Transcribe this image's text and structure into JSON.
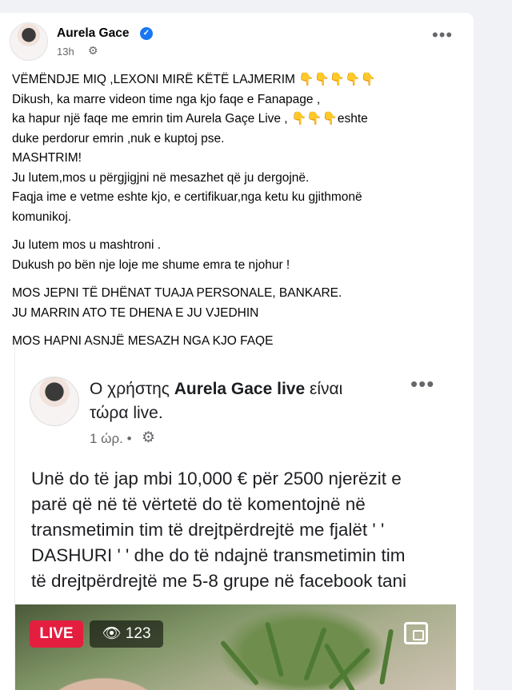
{
  "post": {
    "author": "Aurela Gace",
    "time": "13h",
    "more": "•••",
    "lines": [
      "VËMËNDJE MIQ ,LEXONI MIRË KËTË LAJMERIM",
      "Dikush, ka marre videon time nga kjo faqe e Fanapage ,",
      "  ka hapur një  faqe me emrin tim Aurela Gaçe Live ,",
      "duke perdorur emrin ,nuk e kuptoj pse.",
      "MASHTRIM!",
      "Ju lutem,mos u përgjigjni në mesazhet që ju dergojnë.",
      "Faqja ime e vetme eshte  kjo, e certifikuar,nga ketu ku gjithmonë",
      "komunikoj.",
      "Ju lutem mos u mashtroni .",
      "Dukush po bën nje loje me shume emra te njohur !",
      "MOS JEPNI TË DHËNAT TUAJA PERSONALE, BANKARE.",
      "JU MARRIN ATO TE DHENA E JU VJEDHIN",
      "MOS HAPNI ASNJË MESAZH NGA KJO FAQE"
    ],
    "emoji_line1": "👇👇👇👇👇",
    "emoji_line3": "👇👇👇",
    "line3_suffix": "eshte"
  },
  "screenshot": {
    "prefix": "Ο χρήστης ",
    "name": "Aurela Gace live",
    "suffix": " είναι",
    "line2": "τώρα live.",
    "time": "1 ώρ. •",
    "more": "•••",
    "body": [
      "Unë do të jap mbi 10,000 € për 2500 njerëzit e",
      "parë që në të vërtetë do të komentojnë në",
      "transmetimin tim të drejtpërdrejtë me fjalët ' '",
      "DASHURI ' ' dhe do të ndajnë transmetimin tim",
      "të drejtpërdrejtë me 5-8 grupe në facebook tani"
    ],
    "live_badge": "LIVE",
    "viewers": "123"
  },
  "icons": {
    "verified": "verified-badge-icon",
    "privacy": "gear-icon",
    "viewers": "eye-icon",
    "pip": "picture-in-picture-icon"
  },
  "colors": {
    "accent": "#1877f2",
    "live": "#e41e3f",
    "text": "#050505",
    "secondary": "#65676b"
  }
}
